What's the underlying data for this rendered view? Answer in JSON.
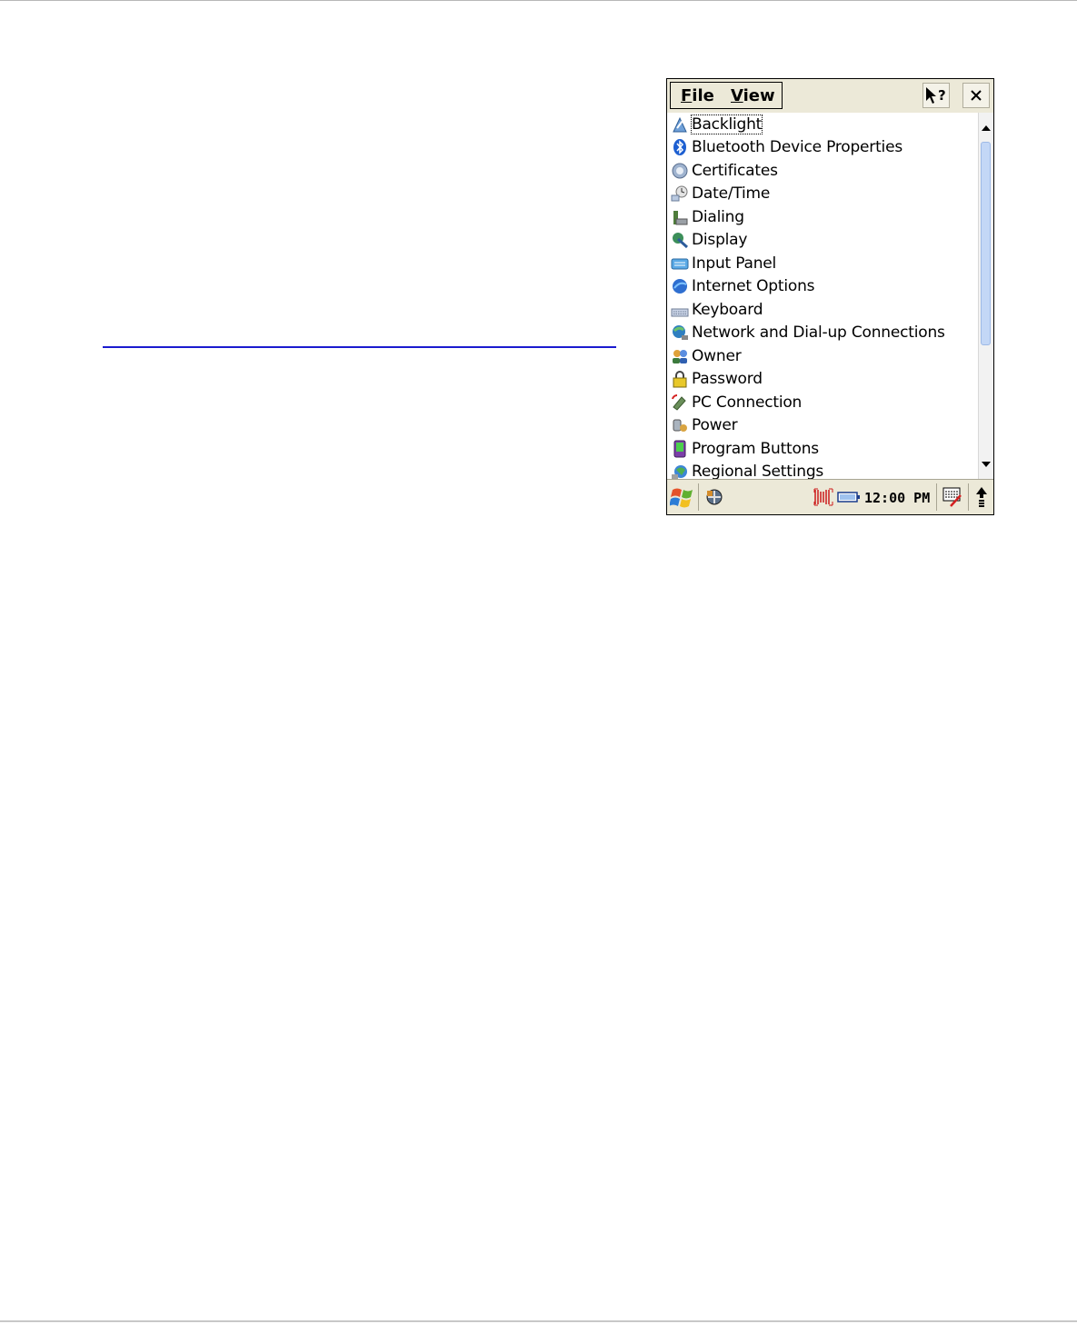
{
  "menubar": {
    "file": {
      "accel": "F",
      "rest": "ile"
    },
    "view": {
      "accel": "V",
      "rest": "iew"
    },
    "help_icon": "pointer-help-icon",
    "close_label": "×"
  },
  "control_panel": {
    "items": [
      {
        "label": "Backlight",
        "icon": "backlight-icon",
        "selected": true
      },
      {
        "label": "Bluetooth Device Properties",
        "icon": "bluetooth-icon"
      },
      {
        "label": "Certificates",
        "icon": "certificates-icon"
      },
      {
        "label": "Date/Time",
        "icon": "date-time-icon"
      },
      {
        "label": "Dialing",
        "icon": "dialing-icon"
      },
      {
        "label": "Display",
        "icon": "display-icon"
      },
      {
        "label": "Input Panel",
        "icon": "input-panel-icon"
      },
      {
        "label": "Internet Options",
        "icon": "internet-options-icon"
      },
      {
        "label": "Keyboard",
        "icon": "keyboard-icon"
      },
      {
        "label": "Network and Dial-up Connections",
        "icon": "network-icon"
      },
      {
        "label": "Owner",
        "icon": "owner-icon"
      },
      {
        "label": "Password",
        "icon": "password-icon"
      },
      {
        "label": "PC Connection",
        "icon": "pc-connection-icon"
      },
      {
        "label": "Power",
        "icon": "power-icon"
      },
      {
        "label": "Program Buttons",
        "icon": "program-buttons-icon"
      },
      {
        "label": "Regional Settings",
        "icon": "regional-settings-icon"
      }
    ]
  },
  "taskbar": {
    "clock": "12:00 PM",
    "icons": [
      "start-icon",
      "connectivity-icon",
      "barcode-scanner-icon",
      "battery-icon",
      "input-panel-toggle-icon",
      "scroll-up-icon"
    ]
  },
  "colors": {
    "chrome": "#ece9d8",
    "link_rule": "#1b1bcf",
    "scroll_thumb": "#c3d7f6"
  }
}
